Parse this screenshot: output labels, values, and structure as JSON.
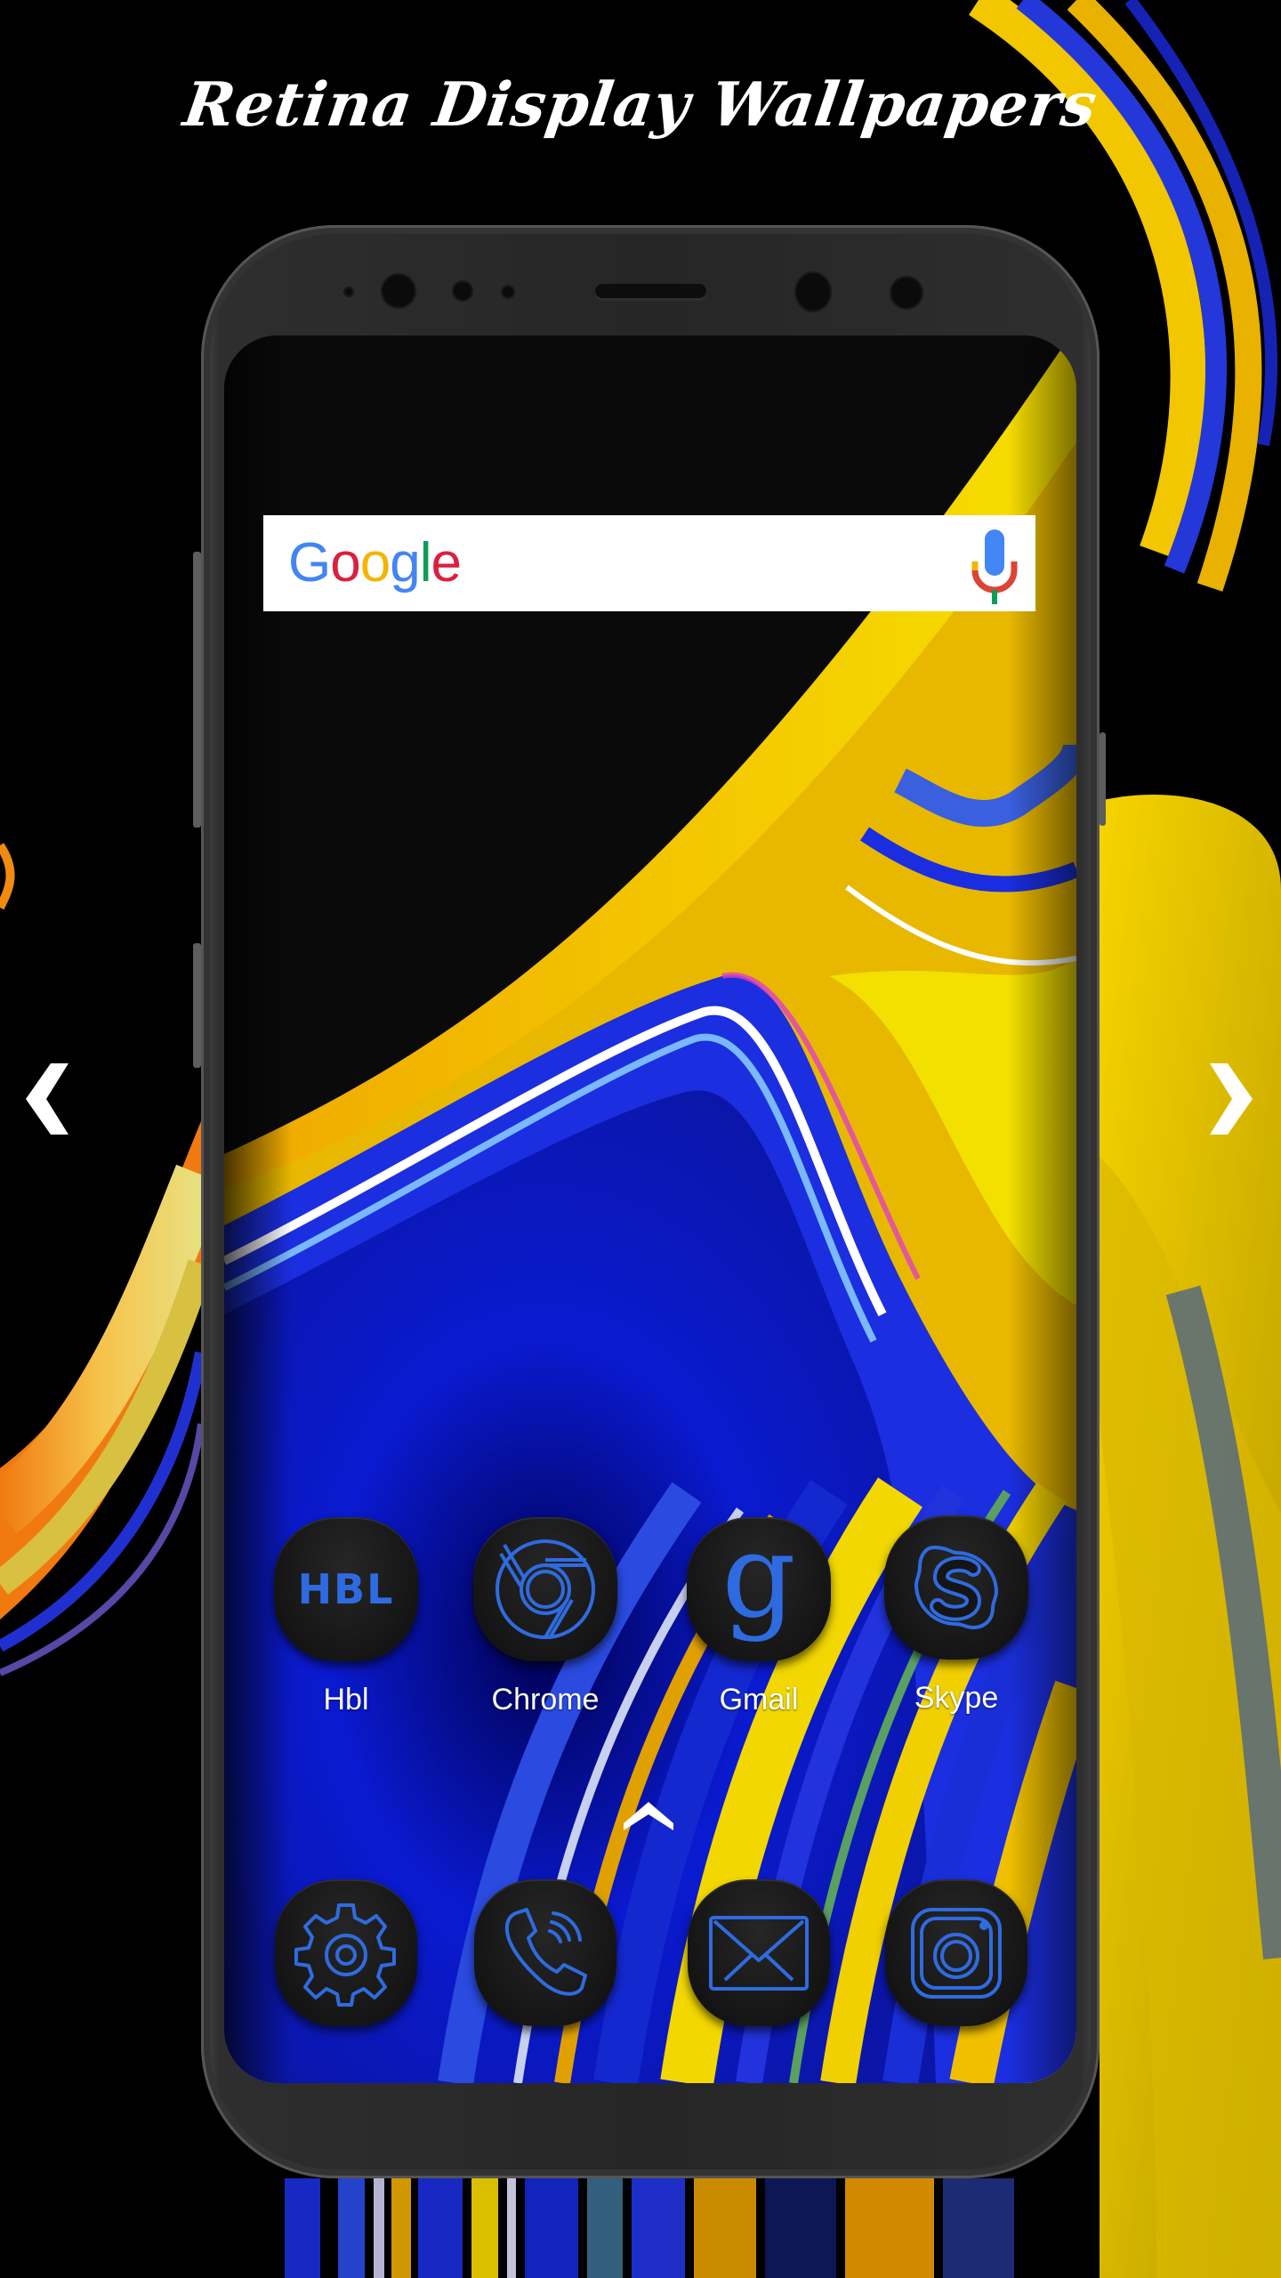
{
  "header": {
    "title": "Retina Display Wallpapers"
  },
  "navigation": {
    "previous": {
      "icon": "chevron-left-icon"
    },
    "next": {
      "icon": "chevron-right-icon"
    }
  },
  "search": {
    "logo_letters": [
      {
        "char": "G",
        "color": "#4285F4"
      },
      {
        "char": "o",
        "color": "#DB1F3F"
      },
      {
        "char": "o",
        "color": "#F4B400"
      },
      {
        "char": "g",
        "color": "#4285F4"
      },
      {
        "char": "l",
        "color": "#0F9D58"
      },
      {
        "char": "e",
        "color": "#DB1F3F"
      }
    ],
    "mic_icon": "microphone-icon"
  },
  "home_apps": [
    {
      "label": "Hbl",
      "icon": "hbl-icon",
      "glyph": "HBL"
    },
    {
      "label": "Chrome",
      "icon": "chrome-icon"
    },
    {
      "label": "Gmail",
      "icon": "google-g-icon",
      "glyph": "g"
    },
    {
      "label": "Skype",
      "icon": "skype-icon"
    }
  ],
  "dock_apps": [
    {
      "name": "Settings",
      "icon": "gear-icon"
    },
    {
      "name": "Phone",
      "icon": "phone-icon"
    },
    {
      "name": "Messages",
      "icon": "envelope-icon"
    },
    {
      "name": "Instagram",
      "icon": "instagram-icon"
    }
  ],
  "app_drawer": {
    "icon": "chevron-up-icon"
  },
  "colors": {
    "icon_accent": "#2F6BE0",
    "background": "#000000",
    "wallpaper_yellow": "#F2D400",
    "wallpaper_blue": "#1A2EE0",
    "wallpaper_orange": "#F08A10"
  }
}
